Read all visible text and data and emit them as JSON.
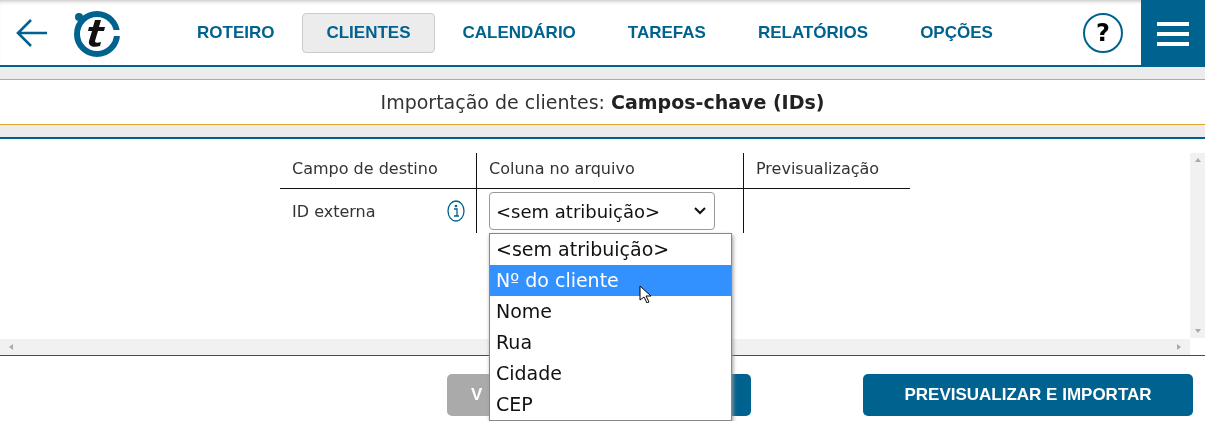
{
  "nav": {
    "tabs": [
      {
        "label": "ROTEIRO",
        "selected": false
      },
      {
        "label": "CLIENTES",
        "selected": true
      },
      {
        "label": "CALENDÁRIO",
        "selected": false
      },
      {
        "label": "TAREFAS",
        "selected": false
      },
      {
        "label": "RELATÓRIOS",
        "selected": false
      },
      {
        "label": "OPÇÕES",
        "selected": false
      }
    ],
    "help": "?"
  },
  "page_title": "Importação de clientes: **Campos-chave (IDs)**",
  "table": {
    "columns": [
      "Campo de destino",
      "Coluna no arquivo",
      "Previsualização"
    ],
    "rows": [
      {
        "field": "ID externa",
        "value": "<sem atribuição>",
        "expanded": true
      }
    ]
  },
  "dropdown_options": [
    {
      "label": "<sem atribuição>",
      "selected": false
    },
    {
      "label": "Nº do cliente",
      "selected": true
    },
    {
      "label": "Nome",
      "selected": false
    },
    {
      "label": "Rua",
      "selected": false
    },
    {
      "label": "Cidade",
      "selected": false
    },
    {
      "label": "CEP",
      "selected": false
    }
  ],
  "buttons": [
    {
      "label": "V",
      "disabled": true
    },
    {
      "disabled": false
    },
    {
      "label": "PREVISUALIZAR E IMPORTAR",
      "disabled": false
    }
  ]
}
